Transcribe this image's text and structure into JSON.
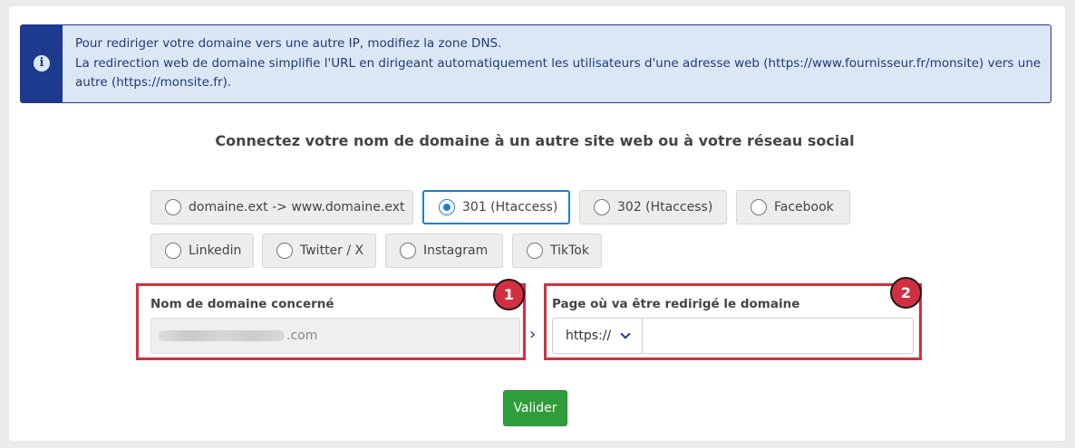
{
  "info": {
    "icon": "info-icon",
    "lines": [
      "Pour rediriger votre domaine vers une autre IP, modifiez la zone DNS.",
      "La redirection web de domaine simplifie l'URL en dirigeant automatiquement les utilisateurs d'une adresse web (https://www.fournisseur.fr/monsite) vers une autre (https://monsite.fr)."
    ]
  },
  "heading": "Connectez votre nom de domaine à un autre site web ou à votre réseau social",
  "options": [
    {
      "label": "domaine.ext -> www.domaine.ext",
      "selected": false
    },
    {
      "label": "301 (Htaccess)",
      "selected": true
    },
    {
      "label": "302 (Htaccess)",
      "selected": false
    },
    {
      "label": "Facebook",
      "selected": false
    },
    {
      "label": "Linkedin",
      "selected": false
    },
    {
      "label": "Twitter / X",
      "selected": false
    },
    {
      "label": "Instagram",
      "selected": false
    },
    {
      "label": "TikTok",
      "selected": false
    }
  ],
  "source": {
    "label": "Nom de domaine concerné",
    "value_suffix": ".com",
    "badge": "1"
  },
  "target": {
    "label": "Page où va être redirigé le domaine",
    "protocol": "https://",
    "value": "",
    "badge": "2"
  },
  "arrow": "›",
  "submit_label": "Valider",
  "colors": {
    "accent_blue": "#1c3b8f",
    "info_bg": "#dce7f6",
    "selected_border": "#1f7ed6",
    "highlight_red": "#d23040",
    "submit_green": "#2f9e3a"
  }
}
